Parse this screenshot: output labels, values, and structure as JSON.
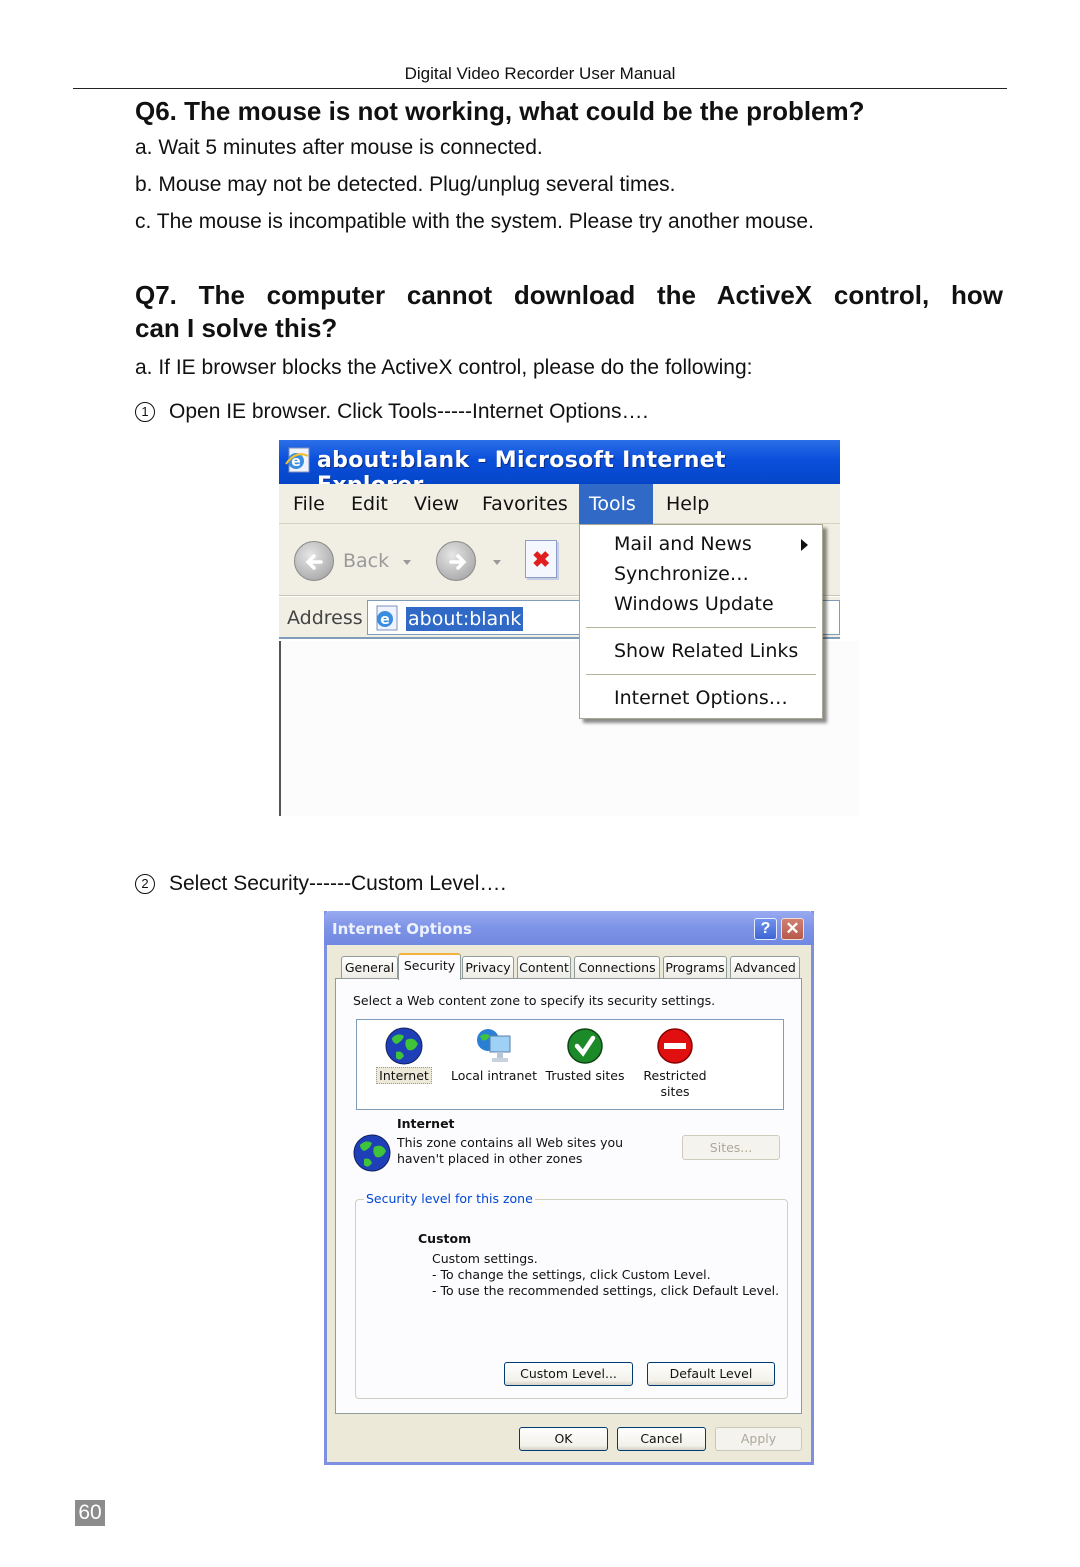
{
  "page": {
    "running_header": "Digital Video Recorder User Manual",
    "page_number": "60"
  },
  "q6": {
    "heading": "Q6. The mouse is not working, what could be the problem?",
    "answers": [
      "a. Wait 5 minutes after mouse is connected.",
      "b. Mouse may not be detected. Plug/unplug several times.",
      "c. The mouse is incompatible with the system. Please try another mouse."
    ]
  },
  "q7": {
    "heading_line1": "Q7. The computer cannot download the ActiveX control, how",
    "heading_line2": "can I solve this?",
    "intro": "a. If IE browser blocks the ActiveX control, please do the following:",
    "steps": [
      {
        "number": "1",
        "text": "Open IE browser. Click Tools-----Internet Options…."
      },
      {
        "number": "2",
        "text": "Select Security------Custom Level…."
      }
    ]
  },
  "ie_window": {
    "title": "about:blank - Microsoft Internet Explorer",
    "menus": [
      "File",
      "Edit",
      "View",
      "Favorites",
      "Tools",
      "Help"
    ],
    "active_menu": "Tools",
    "toolbar": {
      "back_label": "Back"
    },
    "address_label": "Address",
    "address_value": "about:blank",
    "tools_menu": [
      {
        "label": "Mail and News",
        "submenu": true
      },
      {
        "label": "Synchronize…"
      },
      {
        "label": "Windows Update"
      },
      {
        "label": "Show Related Links"
      },
      {
        "label": "Internet Options…"
      }
    ],
    "colors": {
      "title_bar": "#0a4fdb",
      "highlight": "#3169c6"
    }
  },
  "internet_options": {
    "title": "Internet Options",
    "help_label": "?",
    "close_label": "✕",
    "tabs": [
      "General",
      "Security",
      "Privacy",
      "Content",
      "Connections",
      "Programs",
      "Advanced"
    ],
    "active_tab": "Security",
    "zone_prompt": "Select a Web content zone to specify its security settings.",
    "zones": [
      {
        "icon": "globe-icon",
        "label": "Internet",
        "selected": true
      },
      {
        "icon": "intranet-icon",
        "label": "Local intranet"
      },
      {
        "icon": "trusted-check-icon",
        "label": "Trusted sites"
      },
      {
        "icon": "restricted-icon",
        "label": "Restricted sites"
      }
    ],
    "selected_zone": {
      "name": "Internet",
      "description_line1": "This zone contains all Web sites you",
      "description_line2": "haven't placed in other zones",
      "sites_button": "Sites..."
    },
    "security_group": {
      "legend": "Security level for this zone",
      "level": "Custom",
      "lines": [
        "Custom settings.",
        "- To change the settings, click Custom Level.",
        "- To use the recommended settings, click Default Level."
      ],
      "custom_level_button": "Custom Level...",
      "default_level_button": "Default Level"
    },
    "buttons": {
      "ok": "OK",
      "cancel": "Cancel",
      "apply": "Apply"
    },
    "colors": {
      "legend": "#0046d5",
      "active_tab_accent": "#f5b13e"
    }
  }
}
